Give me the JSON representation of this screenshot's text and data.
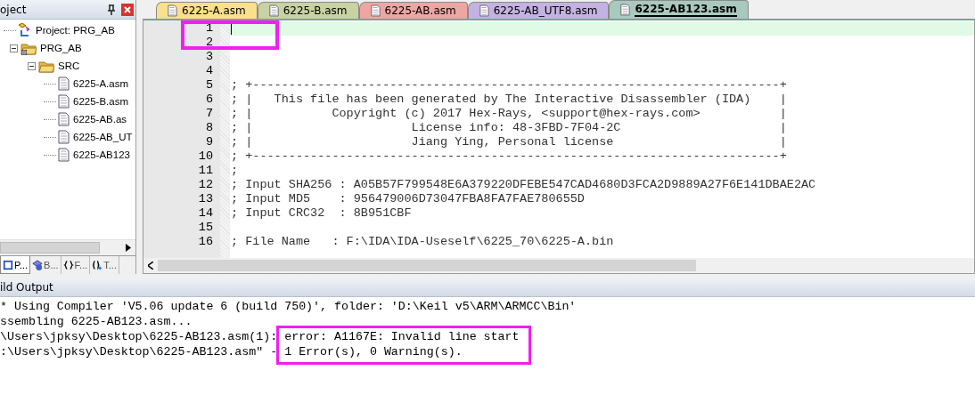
{
  "project_panel": {
    "title": "oject",
    "tree": [
      {
        "label": "Project: PRG_AB",
        "kind": "project",
        "children": [
          {
            "label": "PRG_AB",
            "kind": "target",
            "expanded": true,
            "children": [
              {
                "label": "SRC",
                "kind": "folder",
                "expanded": true,
                "children": [
                  {
                    "label": "6225-A.asm",
                    "kind": "file"
                  },
                  {
                    "label": "6225-B.asm",
                    "kind": "file"
                  },
                  {
                    "label": "6225-AB.as",
                    "kind": "file"
                  },
                  {
                    "label": "6225-AB_UT",
                    "kind": "file"
                  },
                  {
                    "label": "6225-AB123",
                    "kind": "file"
                  }
                ]
              }
            ]
          }
        ]
      }
    ],
    "bottom_tabs": [
      {
        "label": "P...",
        "kind": "project",
        "selected": true
      },
      {
        "label": "B...",
        "kind": "books",
        "selected": false
      },
      {
        "label": "F...",
        "kind": "functions",
        "selected": false
      },
      {
        "label": "T...",
        "kind": "templates",
        "selected": false
      }
    ]
  },
  "editor": {
    "tabs": [
      {
        "label": "6225-A.asm",
        "color": "#fbe08c",
        "selected": false
      },
      {
        "label": "6225-B.asm",
        "color": "#c8d2a2",
        "selected": false
      },
      {
        "label": "6225-AB.asm",
        "color": "#eea6a2",
        "selected": false
      },
      {
        "label": "6225-AB_UTF8.asm",
        "color": "#c4b2e2",
        "selected": false
      },
      {
        "label": "6225-AB123.asm",
        "color": "#a9c9bf",
        "selected": true
      }
    ],
    "lines": [
      {
        "number": "1",
        "current": true
      },
      {
        "number": "2",
        "current": false
      },
      {
        "number": "3",
        "current": false
      },
      {
        "number": "4",
        "current": false
      },
      {
        "number": "5",
        "current": false,
        "text": "; +-------------------------------------------------------------------------+"
      },
      {
        "number": "6",
        "current": false,
        "text": "; |   This file has been generated by The Interactive Disassembler (IDA)    |"
      },
      {
        "number": "7",
        "current": false,
        "text": "; |           Copyright (c) 2017 Hex-Rays, <support@hex-rays.com>           |"
      },
      {
        "number": "8",
        "current": false,
        "text": "; |                      License info: 48-3FBD-7F04-2C                      |"
      },
      {
        "number": "9",
        "current": false,
        "text": "; |                      Jiang Ying, Personal license                       |"
      },
      {
        "number": "10",
        "current": false,
        "text": "; +-------------------------------------------------------------------------+"
      },
      {
        "number": "11",
        "current": false,
        "text": ";"
      },
      {
        "number": "12",
        "current": false,
        "text": "; Input SHA256 : A05B57F799548E6A379220DFEBE547CAD4680D3FCA2D9889A27F6E141DBAE2AC"
      },
      {
        "number": "13",
        "current": false,
        "text": "; Input MD5    : 956479006D73047FBA8FA7FAE780655D"
      },
      {
        "number": "14",
        "current": false,
        "text": "; Input CRC32  : 8B951CBF"
      },
      {
        "number": "15",
        "current": false
      },
      {
        "number": "16",
        "current": false,
        "text": "; File Name   : F:\\IDA\\IDA-Useself\\6225_70\\6225-A.bin"
      }
    ]
  },
  "build_output": {
    "title": "ild Output",
    "lines": [
      "* Using Compiler 'V5.06 update 6 (build 750)', folder: 'D:\\Keil v5\\ARM\\ARMCC\\Bin'",
      "ssembling 6225-AB123.asm...",
      "\\Users\\jpksy\\Desktop\\6225-AB123.asm(1): error: A1167E: Invalid line start",
      ":\\Users\\jpksy\\Desktop\\6225-AB123.asm\" - 1 Error(s), 0 Warning(s)."
    ]
  },
  "highlights": {
    "line_numbers": true,
    "error_message": true
  }
}
